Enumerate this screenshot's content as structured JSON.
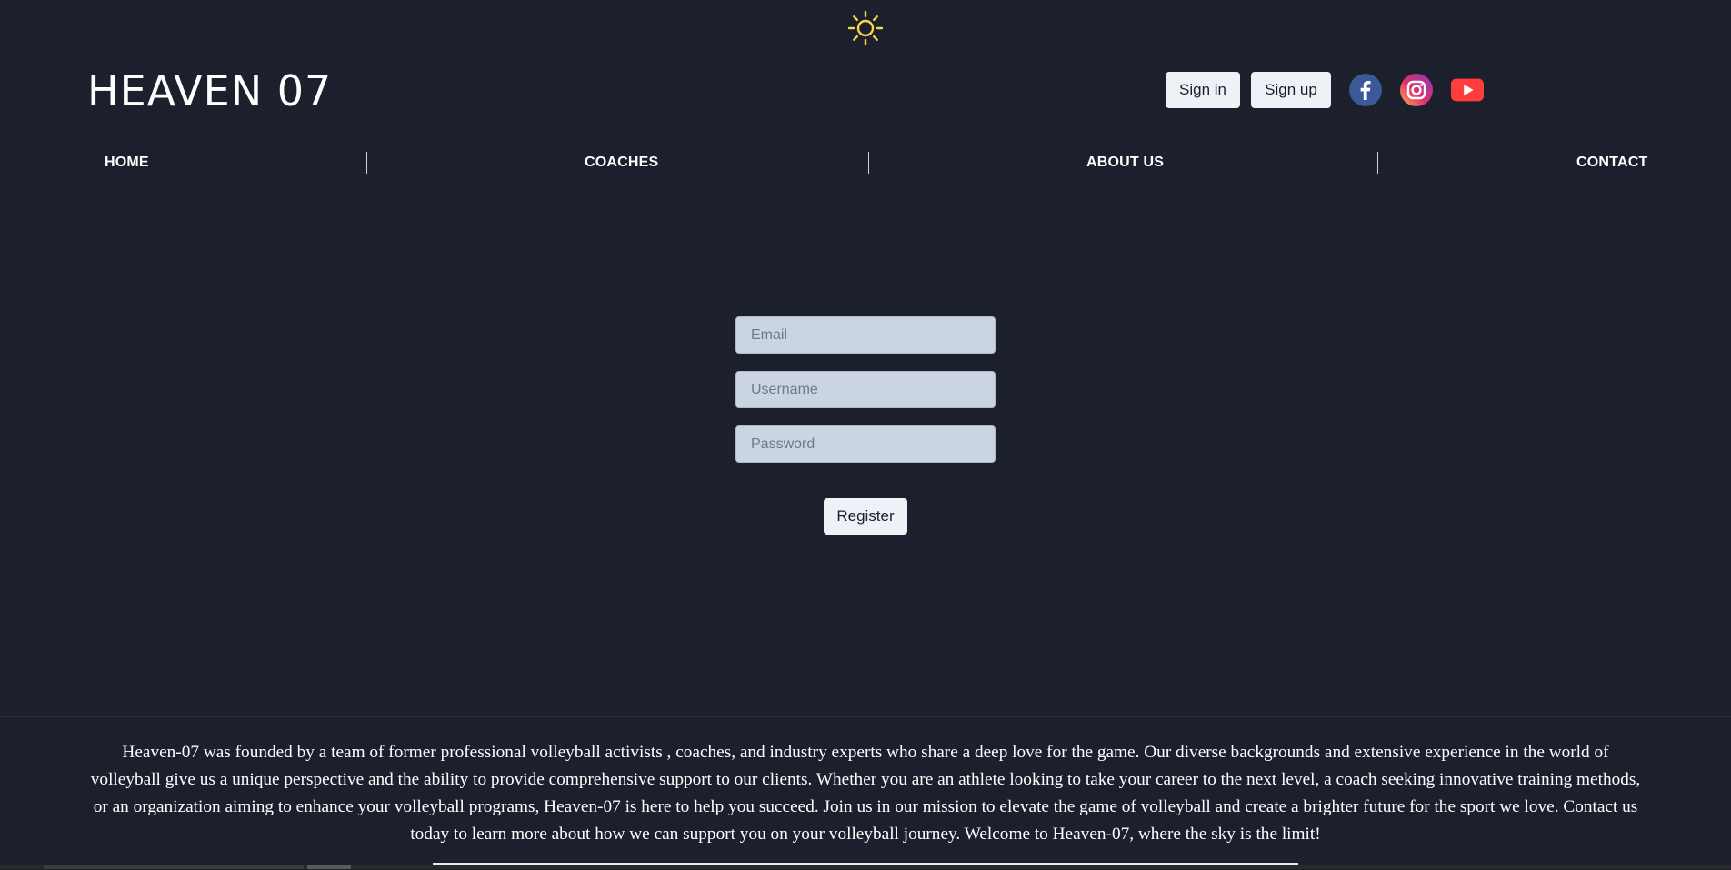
{
  "theme_toggle": {
    "icon": "sun-icon",
    "color": "#f4d84a"
  },
  "header": {
    "logo": "HEAVEN 07",
    "sign_in_label": "Sign in",
    "sign_up_label": "Sign up",
    "social": [
      {
        "icon": "facebook-icon",
        "color": "#3b5998"
      },
      {
        "icon": "instagram-icon",
        "color": "#e1306c"
      },
      {
        "icon": "youtube-icon",
        "color": "#ff3d3d"
      }
    ]
  },
  "nav": {
    "items": [
      {
        "label": "HOME"
      },
      {
        "label": "COACHES"
      },
      {
        "label": "ABOUT US"
      },
      {
        "label": "CONTACT"
      }
    ]
  },
  "form": {
    "email_placeholder": "Email",
    "username_placeholder": "Username",
    "password_placeholder": "Password",
    "register_label": "Register"
  },
  "footer": {
    "text": "Heaven-07 was founded by a team of former professional volleyball activists , coaches, and industry experts who share a deep love for the game. Our diverse backgrounds and extensive experience in the world of volleyball give us a unique perspective and the ability to provide comprehensive support to our clients. Whether you are an athlete looking to take your career to the next level, a coach seeking innovative training methods, or an organization aiming to enhance your volleyball programs, Heaven-07 is here to help you succeed. Join us in our mission to elevate the game of volleyball and create a brighter future for the sport we love. Contact us today to learn more about how we can support you on your volleyball journey. Welcome to Heaven-07, where the sky is the limit!"
  },
  "colors": {
    "background": "#1b202c",
    "input_bg": "#cbd5e1",
    "button_bg": "#eef1f5",
    "text": "#ffffff"
  }
}
